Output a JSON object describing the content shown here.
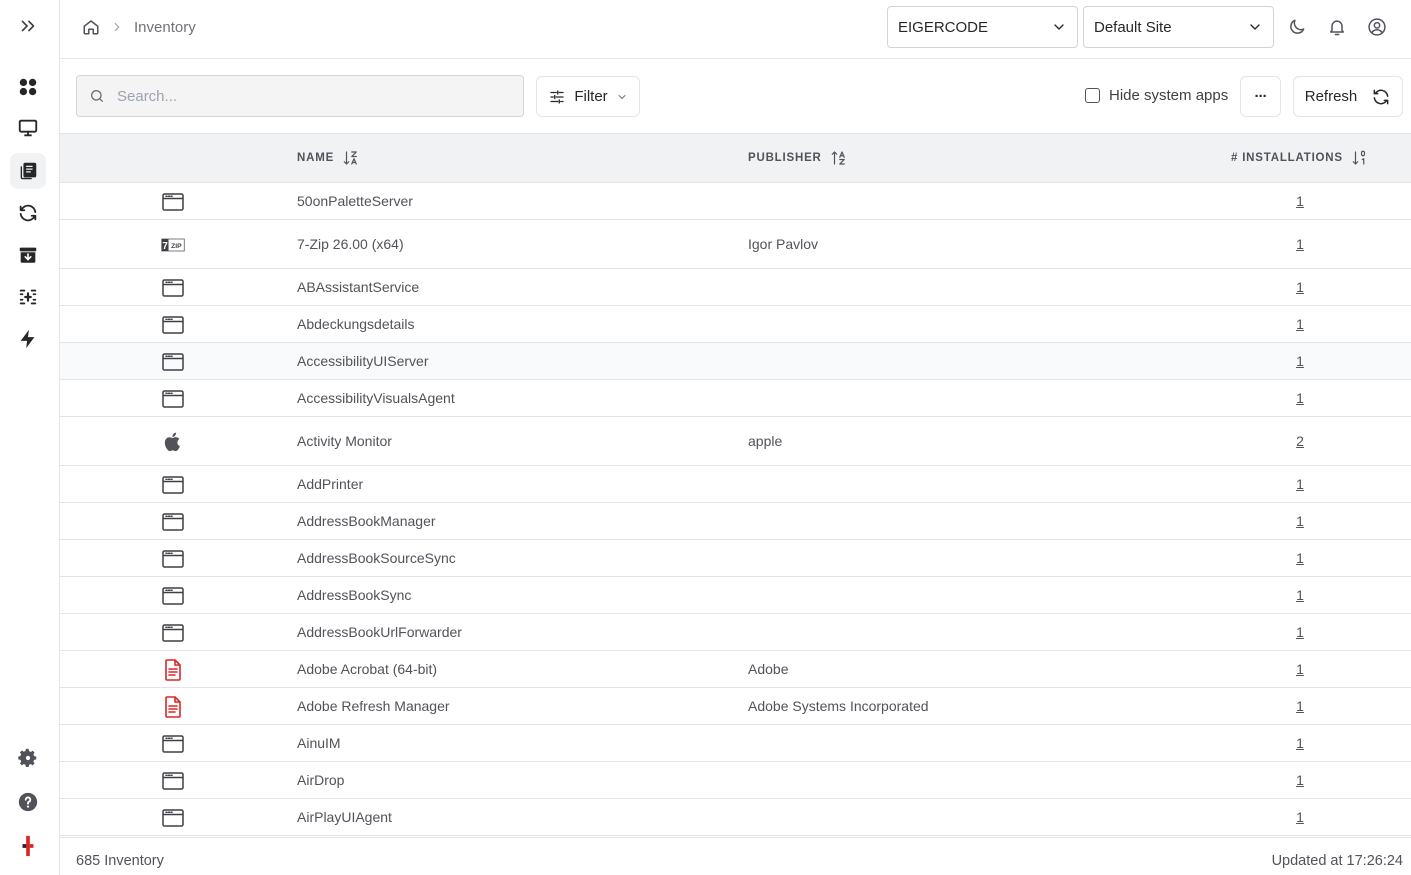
{
  "sidebar": {
    "items": [
      {
        "name": "expand-sidebar-icon"
      },
      {
        "name": "dashboard-icon"
      },
      {
        "name": "devices-icon"
      },
      {
        "name": "inventory-icon",
        "active": true
      },
      {
        "name": "sync-icon"
      },
      {
        "name": "archive-icon"
      },
      {
        "name": "scan-icon"
      },
      {
        "name": "automation-icon"
      },
      {
        "name": "gear-icon"
      },
      {
        "name": "help-icon"
      },
      {
        "name": "brand-logo"
      }
    ]
  },
  "header": {
    "breadcrumb": {
      "current": "Inventory"
    },
    "org_select": "EIGERCODE",
    "site_select": "Default Site"
  },
  "toolbar": {
    "search_placeholder": "Search...",
    "filter_label": "Filter",
    "hide_system_label": "Hide system apps",
    "more_label": "···",
    "refresh_label": "Refresh"
  },
  "table": {
    "columns": [
      "NAME",
      "PUBLISHER",
      "# INSTALLATIONS"
    ],
    "rows": [
      {
        "icon": "app-window-icon",
        "name": "50onPaletteServer",
        "publisher": "",
        "installations": "1"
      },
      {
        "icon": "7zip-icon",
        "name": "7-Zip 26.00 (x64)",
        "publisher": "Igor Pavlov",
        "installations": "1"
      },
      {
        "icon": "app-window-icon",
        "name": "ABAssistantService",
        "publisher": "",
        "installations": "1"
      },
      {
        "icon": "app-window-icon",
        "name": "Abdeckungsdetails",
        "publisher": "",
        "installations": "1"
      },
      {
        "icon": "app-window-icon",
        "name": "AccessibilityUIServer",
        "publisher": "",
        "installations": "1"
      },
      {
        "icon": "app-window-icon",
        "name": "AccessibilityVisualsAgent",
        "publisher": "",
        "installations": "1"
      },
      {
        "icon": "apple-icon",
        "name": "Activity Monitor",
        "publisher": "apple",
        "installations": "2"
      },
      {
        "icon": "app-window-icon",
        "name": "AddPrinter",
        "publisher": "",
        "installations": "1"
      },
      {
        "icon": "app-window-icon",
        "name": "AddressBookManager",
        "publisher": "",
        "installations": "1"
      },
      {
        "icon": "app-window-icon",
        "name": "AddressBookSourceSync",
        "publisher": "",
        "installations": "1"
      },
      {
        "icon": "app-window-icon",
        "name": "AddressBookSync",
        "publisher": "",
        "installations": "1"
      },
      {
        "icon": "app-window-icon",
        "name": "AddressBookUrlForwarder",
        "publisher": "",
        "installations": "1"
      },
      {
        "icon": "pdf-document-icon",
        "name": "Adobe Acrobat (64-bit)",
        "publisher": "Adobe",
        "installations": "1"
      },
      {
        "icon": "pdf-document-icon",
        "name": "Adobe Refresh Manager",
        "publisher": "Adobe Systems Incorporated",
        "installations": "1"
      },
      {
        "icon": "app-window-icon",
        "name": "AinuIM",
        "publisher": "",
        "installations": "1"
      },
      {
        "icon": "app-window-icon",
        "name": "AirDrop",
        "publisher": "",
        "installations": "1"
      },
      {
        "icon": "app-window-icon",
        "name": "AirPlayUIAgent",
        "publisher": "",
        "installations": "1"
      }
    ]
  },
  "footer": {
    "count": "685 Inventory",
    "updated": "Updated at 17:26:24"
  },
  "colors": {
    "accent_red": "#dc2626",
    "icon_dark": "#27272a",
    "border": "#e4e4e7",
    "header_bg": "#f1f2f4"
  }
}
